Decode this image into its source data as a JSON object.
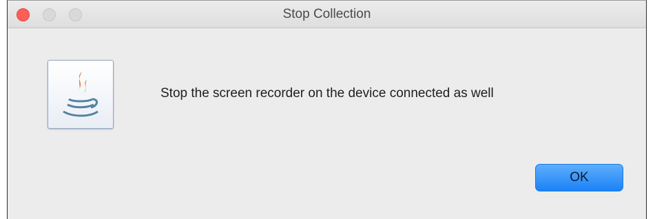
{
  "window": {
    "title": "Stop Collection",
    "controls": [
      "close",
      "minimize",
      "zoom"
    ]
  },
  "dialog": {
    "icon": "java-coffee-icon",
    "message": "Stop the screen recorder on the device connected as well",
    "ok_label": "OK"
  },
  "colors": {
    "close": "#fd5f57",
    "ok_button": "#1c82f6",
    "background": "#ececec"
  }
}
